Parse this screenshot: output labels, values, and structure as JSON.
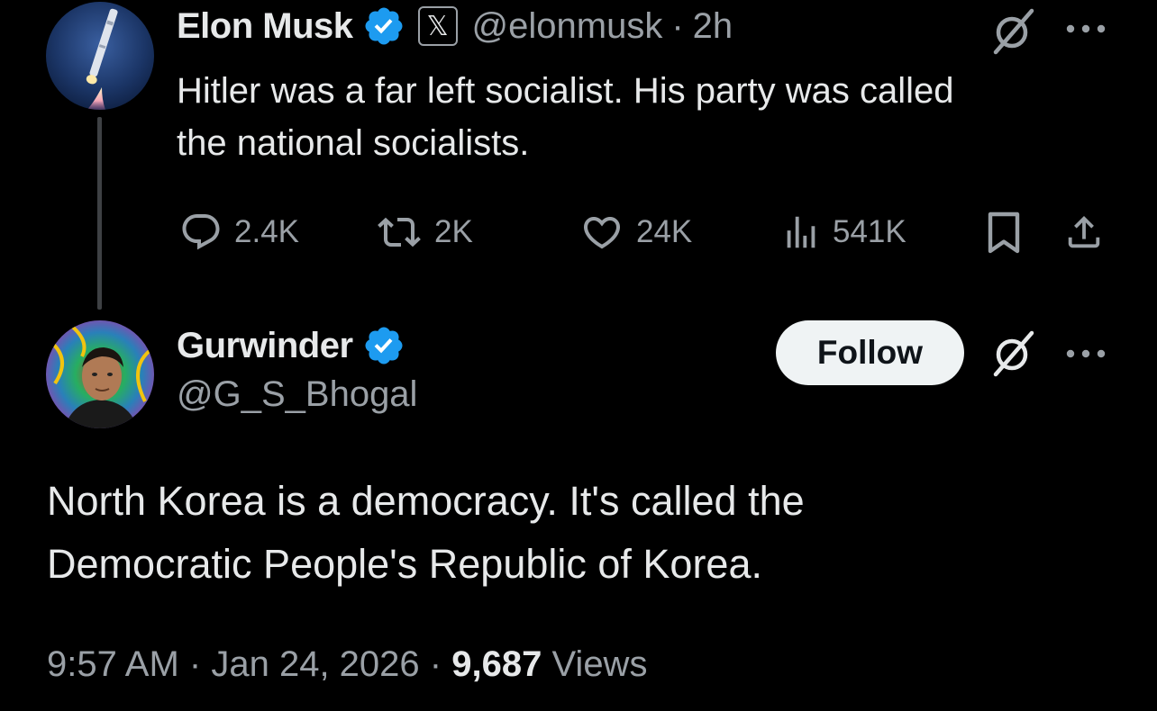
{
  "parent_tweet": {
    "author_name": "Elon Musk",
    "badge_icon": "x-logo-icon",
    "badge_glyph": "𝕏",
    "handle": "@elonmusk",
    "separator": "·",
    "time": "2h",
    "text_line1": "Hitler was a far left socialist. His party was called",
    "text_line2": "the national socialists.",
    "replies": "2.4K",
    "reposts": "2K",
    "likes": "24K",
    "views": "541K"
  },
  "reply_tweet": {
    "author_name": "Gurwinder",
    "handle": "@G_S_Bhogal",
    "follow_label": "Follow",
    "text_line1": "North Korea is a democracy. It's called the",
    "text_line2": "Democratic People's Republic of Korea.",
    "time": "9:57 AM",
    "separator": "·",
    "date": "Jan 24, 2026",
    "views_count": "9,687",
    "views_label": "Views"
  },
  "colors": {
    "background": "#000000",
    "text_primary": "#e7e9ea",
    "text_secondary": "#9aa0a6",
    "verified_blue": "#1d9bf0",
    "follow_bg": "#eff3f4",
    "thread_line": "#3e4144"
  }
}
